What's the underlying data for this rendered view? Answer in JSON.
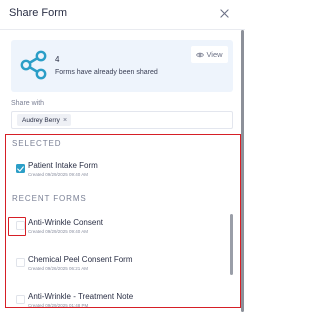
{
  "header": {
    "title": "Share Form"
  },
  "share_summary": {
    "count": "4",
    "text": "Forms have already been shared",
    "view_label": "View",
    "icon": "share-icon"
  },
  "share_with": {
    "label": "Share with",
    "chips": [
      {
        "name": "Audrey Berry"
      }
    ]
  },
  "selected_section": {
    "label": "SELECTED",
    "items": [
      {
        "name": "Patient Intake Form",
        "created": "Created 09/29/2025 09:40 AM",
        "checked": true
      }
    ]
  },
  "recent_section": {
    "label": "RECENT FORMS",
    "items": [
      {
        "name": "Anti-Wrinkle Consent",
        "created": "Created 09/29/2025 09:40 AM",
        "checked": false
      },
      {
        "name": "Chemical Peel Consent Form",
        "created": "Created 09/26/2025 06:21 AM",
        "checked": false
      },
      {
        "name": "Anti-Wrinkle - Treatment Note",
        "created": "Created 09/29/2025 01:48 PM",
        "checked": false
      }
    ]
  },
  "colors": {
    "accent": "#2b9ec7",
    "highlight_outline": "#d61f26",
    "card_background": "#eef4fc"
  }
}
